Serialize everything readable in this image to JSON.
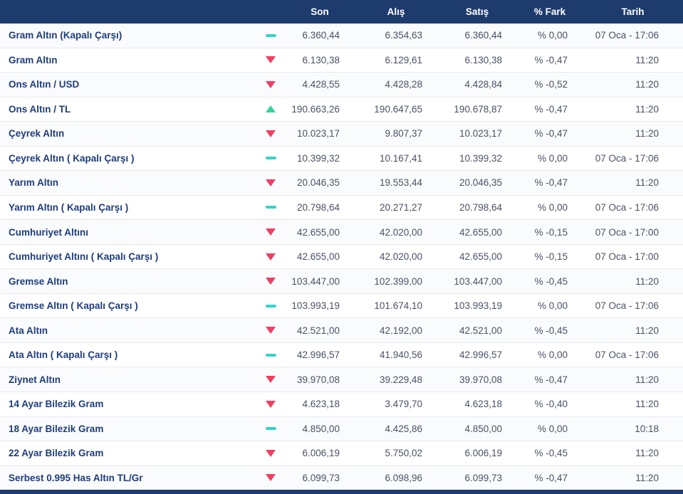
{
  "header": {
    "columns": [
      "Son",
      "Alış",
      "Satış",
      "% Fark",
      "Tarih"
    ]
  },
  "colors": {
    "header_bg": "#1d3b6c",
    "name_text": "#1e3d7b",
    "value_text": "#4a5166",
    "trend_down": "#f43d62",
    "trend_up": "#33d49e",
    "trend_flat": "#35d3c8"
  },
  "rows": [
    {
      "name": "Gram Altın (Kapalı Çarşı)",
      "trend": "flat",
      "son": "6.360,44",
      "alis": "6.354,63",
      "satis": "6.360,44",
      "fark": "% 0,00",
      "tarih": "07 Oca - 17:06"
    },
    {
      "name": "Gram Altın",
      "trend": "down",
      "son": "6.130,38",
      "alis": "6.129,61",
      "satis": "6.130,38",
      "fark": "% -0,47",
      "tarih": "11:20"
    },
    {
      "name": "Ons Altın / USD",
      "trend": "down",
      "son": "4.428,55",
      "alis": "4.428,28",
      "satis": "4.428,84",
      "fark": "% -0,52",
      "tarih": "11:20"
    },
    {
      "name": "Ons Altın / TL",
      "trend": "up",
      "son": "190.663,26",
      "alis": "190.647,65",
      "satis": "190.678,87",
      "fark": "% -0,47",
      "tarih": "11:20"
    },
    {
      "name": "Çeyrek Altın",
      "trend": "down",
      "son": "10.023,17",
      "alis": "9.807,37",
      "satis": "10.023,17",
      "fark": "% -0,47",
      "tarih": "11:20"
    },
    {
      "name": "Çeyrek Altın ( Kapalı Çarşı )",
      "trend": "flat",
      "son": "10.399,32",
      "alis": "10.167,41",
      "satis": "10.399,32",
      "fark": "% 0,00",
      "tarih": "07 Oca - 17:06"
    },
    {
      "name": "Yarım Altın",
      "trend": "down",
      "son": "20.046,35",
      "alis": "19.553,44",
      "satis": "20.046,35",
      "fark": "% -0,47",
      "tarih": "11:20"
    },
    {
      "name": "Yarım Altın ( Kapalı Çarşı )",
      "trend": "flat",
      "son": "20.798,64",
      "alis": "20.271,27",
      "satis": "20.798,64",
      "fark": "% 0,00",
      "tarih": "07 Oca - 17:06"
    },
    {
      "name": "Cumhuriyet Altını",
      "trend": "down",
      "son": "42.655,00",
      "alis": "42.020,00",
      "satis": "42.655,00",
      "fark": "% -0,15",
      "tarih": "07 Oca - 17:00"
    },
    {
      "name": "Cumhuriyet Altını ( Kapalı Çarşı )",
      "trend": "down",
      "son": "42.655,00",
      "alis": "42.020,00",
      "satis": "42.655,00",
      "fark": "% -0,15",
      "tarih": "07 Oca - 17:00"
    },
    {
      "name": "Gremse Altın",
      "trend": "down",
      "son": "103.447,00",
      "alis": "102.399,00",
      "satis": "103.447,00",
      "fark": "% -0,45",
      "tarih": "11:20"
    },
    {
      "name": "Gremse Altın ( Kapalı Çarşı )",
      "trend": "flat",
      "son": "103.993,19",
      "alis": "101.674,10",
      "satis": "103.993,19",
      "fark": "% 0,00",
      "tarih": "07 Oca - 17:06"
    },
    {
      "name": "Ata Altın",
      "trend": "down",
      "son": "42.521,00",
      "alis": "42.192,00",
      "satis": "42.521,00",
      "fark": "% -0,45",
      "tarih": "11:20"
    },
    {
      "name": "Ata Altın ( Kapalı Çarşı )",
      "trend": "flat",
      "son": "42.996,57",
      "alis": "41.940,56",
      "satis": "42.996,57",
      "fark": "% 0,00",
      "tarih": "07 Oca - 17:06"
    },
    {
      "name": "Ziynet Altın",
      "trend": "down",
      "son": "39.970,08",
      "alis": "39.229,48",
      "satis": "39.970,08",
      "fark": "% -0,47",
      "tarih": "11:20"
    },
    {
      "name": "14 Ayar Bilezik Gram",
      "trend": "down",
      "son": "4.623,18",
      "alis": "3.479,70",
      "satis": "4.623,18",
      "fark": "% -0,40",
      "tarih": "11:20"
    },
    {
      "name": "18 Ayar Bilezik Gram",
      "trend": "flat",
      "son": "4.850,00",
      "alis": "4.425,86",
      "satis": "4.850,00",
      "fark": "% 0,00",
      "tarih": "10:18"
    },
    {
      "name": "22 Ayar Bilezik Gram",
      "trend": "down",
      "son": "6.006,19",
      "alis": "5.750,02",
      "satis": "6.006,19",
      "fark": "% -0,45",
      "tarih": "11:20"
    },
    {
      "name": "Serbest 0.995 Has Altın TL/Gr",
      "trend": "down",
      "son": "6.099,73",
      "alis": "6.098,96",
      "satis": "6.099,73",
      "fark": "% -0,47",
      "tarih": "11:20"
    }
  ]
}
